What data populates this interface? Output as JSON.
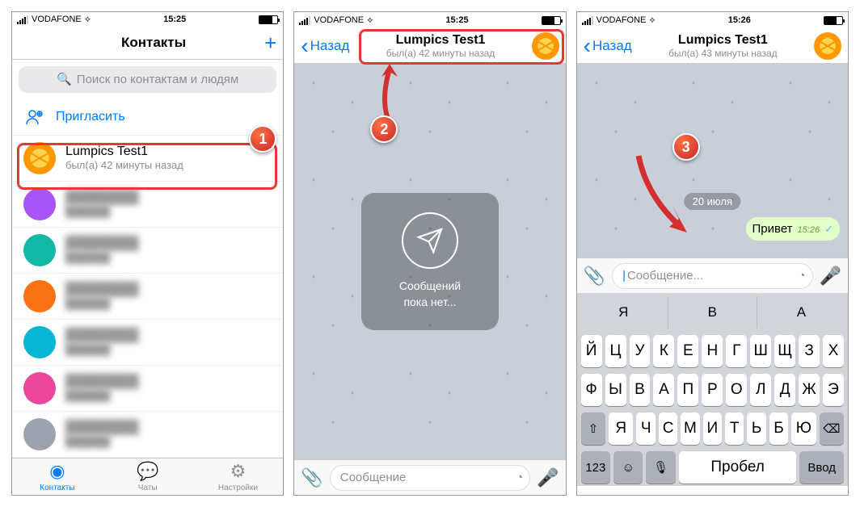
{
  "status": {
    "carrier": "VODAFONE",
    "times": [
      "15:25",
      "15:25",
      "15:26"
    ]
  },
  "screen1": {
    "title": "Контакты",
    "search_placeholder": "Поиск по контактам и людям",
    "invite_label": "Пригласить",
    "contact": {
      "name": "Lumpics Test1",
      "status": "был(а) 42 минуты назад"
    },
    "tabs": {
      "contacts": "Контакты",
      "chats": "Чаты",
      "settings": "Настройки"
    }
  },
  "screen2": {
    "back": "Назад",
    "chat_name": "Lumpics Test1",
    "chat_status": "был(а) 42 минуты назад",
    "empty_line1": "Сообщений",
    "empty_line2": "пока нет...",
    "input_placeholder": "Сообщение"
  },
  "screen3": {
    "back": "Назад",
    "chat_name": "Lumpics Test1",
    "chat_status": "был(а) 43 минуты назад",
    "date": "20 июля",
    "msg_text": "Привет",
    "msg_time": "15:26",
    "input_placeholder": "Сообщение...",
    "suggestions": [
      "Я",
      "В",
      "А"
    ],
    "kbd_row1": [
      "Й",
      "Ц",
      "У",
      "К",
      "Е",
      "Н",
      "Г",
      "Ш",
      "Щ",
      "З",
      "Х"
    ],
    "kbd_row2": [
      "Ф",
      "Ы",
      "В",
      "А",
      "П",
      "Р",
      "О",
      "Л",
      "Д",
      "Ж",
      "Э"
    ],
    "kbd_row3": [
      "Я",
      "Ч",
      "С",
      "М",
      "И",
      "Т",
      "Ь",
      "Б",
      "Ю"
    ],
    "kbd_123": "123",
    "kbd_space": "Пробел",
    "kbd_enter": "Ввод"
  },
  "steps": {
    "s1": "1",
    "s2": "2",
    "s3": "3"
  }
}
